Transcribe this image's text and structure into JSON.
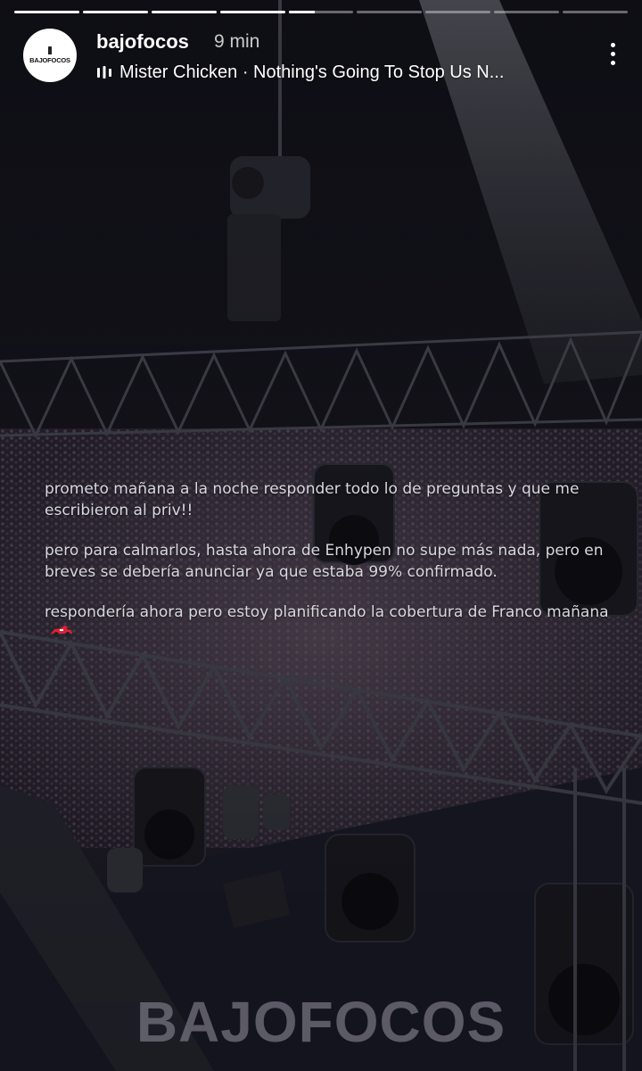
{
  "story": {
    "progress_segments": [
      1,
      1,
      1,
      1,
      0.4,
      0,
      0,
      0,
      0
    ],
    "account": {
      "avatar_text": "BAJOFOCOS",
      "username": "bajofocos",
      "time_ago": "9 min"
    },
    "music": {
      "icon": "music-bars-icon",
      "label": "Mister Chicken · Nothing's Going To Stop Us N..."
    },
    "more_icon": "more-vertical-icon",
    "message": {
      "paragraph_1": "prometo mañana a la noche responder todo lo de preguntas y que me escribieron al priv!!",
      "paragraph_2": "pero para calmarlos, hasta ahora de Enhypen no supe más nada, pero en breves se debería anunciar ya que estaba 99% confirmado.",
      "paragraph_3": "respondería ahora pero estoy planificando la cobertura de Franco mañana",
      "paragraph_3_emoji": "race-car-icon"
    },
    "watermark": "BAJOFOCOS"
  },
  "colors": {
    "background": "#14131b",
    "progress_active": "#ffffff",
    "progress_inactive": "rgba(255,255,255,0.38)",
    "text": "#d8d8de",
    "watermark": "#96949f"
  }
}
